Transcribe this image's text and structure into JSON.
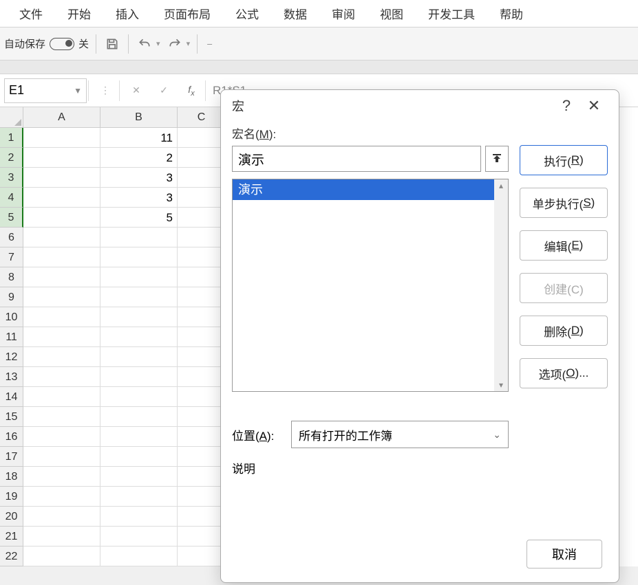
{
  "ribbon": {
    "tabs": [
      "文件",
      "开始",
      "插入",
      "页面布局",
      "公式",
      "数据",
      "审阅",
      "视图",
      "开发工具",
      "帮助"
    ],
    "autosave_label": "自动保存",
    "autosave_state": "关"
  },
  "namebox": {
    "value": "E1"
  },
  "formula_preview": "R1*S1",
  "columns": [
    "A",
    "B",
    "C"
  ],
  "rows": [
    {
      "n": "1",
      "A": "",
      "B": "11"
    },
    {
      "n": "2",
      "A": "",
      "B": "2"
    },
    {
      "n": "3",
      "A": "",
      "B": "3"
    },
    {
      "n": "4",
      "A": "",
      "B": "3"
    },
    {
      "n": "5",
      "A": "",
      "B": "5"
    },
    {
      "n": "6",
      "A": "",
      "B": ""
    },
    {
      "n": "7",
      "A": "",
      "B": ""
    },
    {
      "n": "8",
      "A": "",
      "B": ""
    },
    {
      "n": "9",
      "A": "",
      "B": ""
    },
    {
      "n": "10",
      "A": "",
      "B": ""
    },
    {
      "n": "11",
      "A": "",
      "B": ""
    },
    {
      "n": "12",
      "A": "",
      "B": ""
    },
    {
      "n": "13",
      "A": "",
      "B": ""
    },
    {
      "n": "14",
      "A": "",
      "B": ""
    },
    {
      "n": "15",
      "A": "",
      "B": ""
    },
    {
      "n": "16",
      "A": "",
      "B": ""
    },
    {
      "n": "17",
      "A": "",
      "B": ""
    },
    {
      "n": "18",
      "A": "",
      "B": ""
    },
    {
      "n": "19",
      "A": "",
      "B": ""
    },
    {
      "n": "20",
      "A": "",
      "B": ""
    },
    {
      "n": "21",
      "A": "",
      "B": ""
    },
    {
      "n": "22",
      "A": "",
      "B": ""
    }
  ],
  "dialog": {
    "title": "宏",
    "name_label": "宏名(M):",
    "name_value": "演示",
    "list": [
      "演示"
    ],
    "location_label": "位置(A):",
    "location_value": "所有打开的工作簿",
    "desc_label": "说明",
    "buttons": {
      "run": "执行(R)",
      "step": "单步执行(S)",
      "edit": "编辑(E)",
      "create": "创建(C)",
      "delete": "删除(D)",
      "options": "选项(O)...",
      "cancel": "取消"
    }
  }
}
